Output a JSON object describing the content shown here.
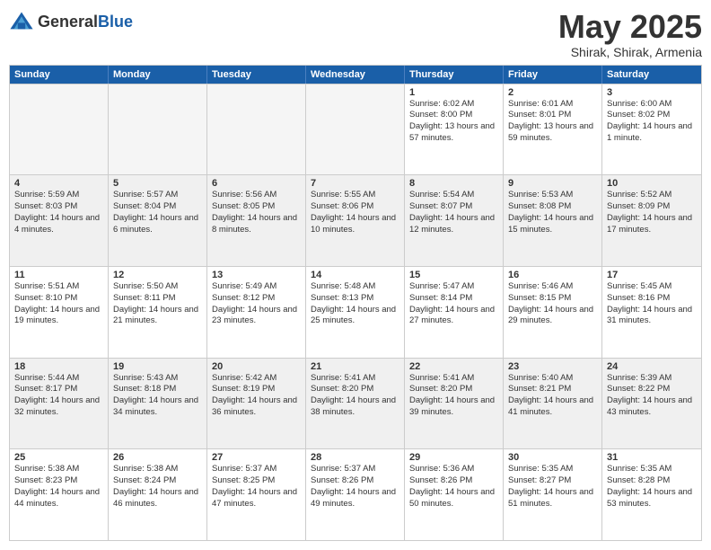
{
  "logo": {
    "general": "General",
    "blue": "Blue"
  },
  "header": {
    "month": "May 2025",
    "location": "Shirak, Shirak, Armenia"
  },
  "weekdays": [
    "Sunday",
    "Monday",
    "Tuesday",
    "Wednesday",
    "Thursday",
    "Friday",
    "Saturday"
  ],
  "rows": [
    [
      {
        "day": "",
        "empty": true
      },
      {
        "day": "",
        "empty": true
      },
      {
        "day": "",
        "empty": true
      },
      {
        "day": "",
        "empty": true
      },
      {
        "day": "1",
        "sunrise": "6:02 AM",
        "sunset": "8:00 PM",
        "daylight": "13 hours and 57 minutes."
      },
      {
        "day": "2",
        "sunrise": "6:01 AM",
        "sunset": "8:01 PM",
        "daylight": "13 hours and 59 minutes."
      },
      {
        "day": "3",
        "sunrise": "6:00 AM",
        "sunset": "8:02 PM",
        "daylight": "14 hours and 1 minute."
      }
    ],
    [
      {
        "day": "4",
        "sunrise": "5:59 AM",
        "sunset": "8:03 PM",
        "daylight": "14 hours and 4 minutes.",
        "shaded": true
      },
      {
        "day": "5",
        "sunrise": "5:57 AM",
        "sunset": "8:04 PM",
        "daylight": "14 hours and 6 minutes.",
        "shaded": true
      },
      {
        "day": "6",
        "sunrise": "5:56 AM",
        "sunset": "8:05 PM",
        "daylight": "14 hours and 8 minutes.",
        "shaded": true
      },
      {
        "day": "7",
        "sunrise": "5:55 AM",
        "sunset": "8:06 PM",
        "daylight": "14 hours and 10 minutes.",
        "shaded": true
      },
      {
        "day": "8",
        "sunrise": "5:54 AM",
        "sunset": "8:07 PM",
        "daylight": "14 hours and 12 minutes.",
        "shaded": true
      },
      {
        "day": "9",
        "sunrise": "5:53 AM",
        "sunset": "8:08 PM",
        "daylight": "14 hours and 15 minutes.",
        "shaded": true
      },
      {
        "day": "10",
        "sunrise": "5:52 AM",
        "sunset": "8:09 PM",
        "daylight": "14 hours and 17 minutes.",
        "shaded": true
      }
    ],
    [
      {
        "day": "11",
        "sunrise": "5:51 AM",
        "sunset": "8:10 PM",
        "daylight": "14 hours and 19 minutes."
      },
      {
        "day": "12",
        "sunrise": "5:50 AM",
        "sunset": "8:11 PM",
        "daylight": "14 hours and 21 minutes."
      },
      {
        "day": "13",
        "sunrise": "5:49 AM",
        "sunset": "8:12 PM",
        "daylight": "14 hours and 23 minutes."
      },
      {
        "day": "14",
        "sunrise": "5:48 AM",
        "sunset": "8:13 PM",
        "daylight": "14 hours and 25 minutes."
      },
      {
        "day": "15",
        "sunrise": "5:47 AM",
        "sunset": "8:14 PM",
        "daylight": "14 hours and 27 minutes."
      },
      {
        "day": "16",
        "sunrise": "5:46 AM",
        "sunset": "8:15 PM",
        "daylight": "14 hours and 29 minutes."
      },
      {
        "day": "17",
        "sunrise": "5:45 AM",
        "sunset": "8:16 PM",
        "daylight": "14 hours and 31 minutes."
      }
    ],
    [
      {
        "day": "18",
        "sunrise": "5:44 AM",
        "sunset": "8:17 PM",
        "daylight": "14 hours and 32 minutes.",
        "shaded": true
      },
      {
        "day": "19",
        "sunrise": "5:43 AM",
        "sunset": "8:18 PM",
        "daylight": "14 hours and 34 minutes.",
        "shaded": true
      },
      {
        "day": "20",
        "sunrise": "5:42 AM",
        "sunset": "8:19 PM",
        "daylight": "14 hours and 36 minutes.",
        "shaded": true
      },
      {
        "day": "21",
        "sunrise": "5:41 AM",
        "sunset": "8:20 PM",
        "daylight": "14 hours and 38 minutes.",
        "shaded": true
      },
      {
        "day": "22",
        "sunrise": "5:41 AM",
        "sunset": "8:20 PM",
        "daylight": "14 hours and 39 minutes.",
        "shaded": true
      },
      {
        "day": "23",
        "sunrise": "5:40 AM",
        "sunset": "8:21 PM",
        "daylight": "14 hours and 41 minutes.",
        "shaded": true
      },
      {
        "day": "24",
        "sunrise": "5:39 AM",
        "sunset": "8:22 PM",
        "daylight": "14 hours and 43 minutes.",
        "shaded": true
      }
    ],
    [
      {
        "day": "25",
        "sunrise": "5:38 AM",
        "sunset": "8:23 PM",
        "daylight": "14 hours and 44 minutes."
      },
      {
        "day": "26",
        "sunrise": "5:38 AM",
        "sunset": "8:24 PM",
        "daylight": "14 hours and 46 minutes."
      },
      {
        "day": "27",
        "sunrise": "5:37 AM",
        "sunset": "8:25 PM",
        "daylight": "14 hours and 47 minutes."
      },
      {
        "day": "28",
        "sunrise": "5:37 AM",
        "sunset": "8:26 PM",
        "daylight": "14 hours and 49 minutes."
      },
      {
        "day": "29",
        "sunrise": "5:36 AM",
        "sunset": "8:26 PM",
        "daylight": "14 hours and 50 minutes."
      },
      {
        "day": "30",
        "sunrise": "5:35 AM",
        "sunset": "8:27 PM",
        "daylight": "14 hours and 51 minutes."
      },
      {
        "day": "31",
        "sunrise": "5:35 AM",
        "sunset": "8:28 PM",
        "daylight": "14 hours and 53 minutes."
      }
    ]
  ]
}
